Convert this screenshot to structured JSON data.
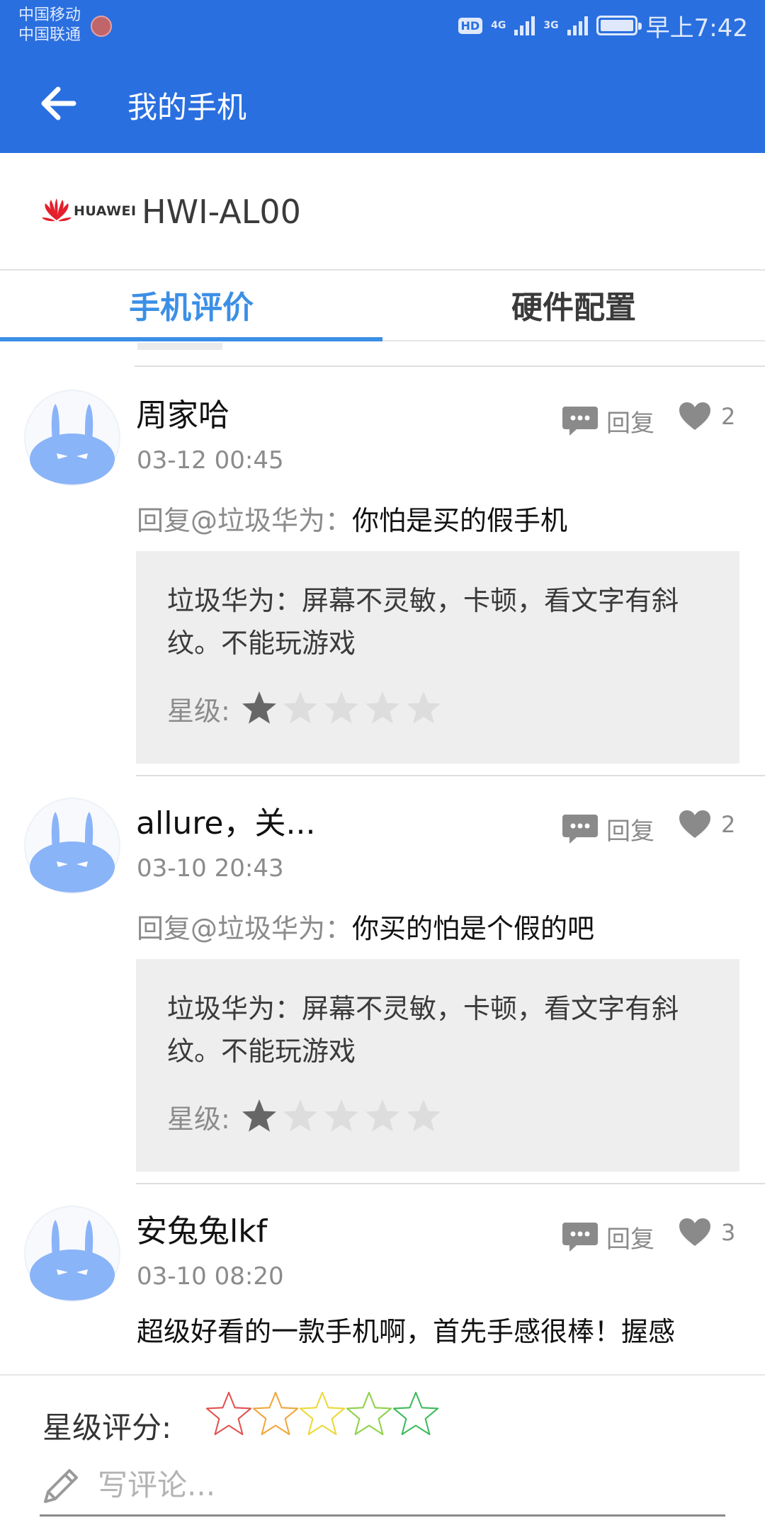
{
  "status_bar": {
    "carrier_1": "中国移动",
    "carrier_2": "中国联通",
    "hd_badge": "HD",
    "network_1": "4G",
    "network_2": "3G",
    "clock": "早上7:42"
  },
  "app_bar": {
    "title": "我的手机",
    "back_icon": "arrow-left-icon"
  },
  "device": {
    "brand": "HUAWEI",
    "model": "HWI-AL00",
    "brand_color": "#e41f2b"
  },
  "tabs": [
    {
      "label": "手机评价",
      "active": true
    },
    {
      "label": "硬件配置",
      "active": false
    }
  ],
  "comments": [
    {
      "author": "周家哈",
      "time": "03-12 00:45",
      "reply_label": "回复",
      "likes": "2",
      "reply_prefix": "回复@垃圾华为：",
      "reply_text": "你怕是买的假手机",
      "quote": "垃圾华为：屏幕不灵敏，卡顿，看文字有斜纹。不能玩游戏",
      "stars_label": "星级:",
      "rating": 1,
      "rating_max": 5
    },
    {
      "author": "allure，关...",
      "time": "03-10 20:43",
      "reply_label": "回复",
      "likes": "2",
      "reply_prefix": "回复@垃圾华为：",
      "reply_text": "你买的怕是个假的吧",
      "quote": "垃圾华为：屏幕不灵敏，卡顿，看文字有斜纹。不能玩游戏",
      "stars_label": "星级:",
      "rating": 1,
      "rating_max": 5
    },
    {
      "author": "安兔兔lkf",
      "time": "03-10 08:20",
      "reply_label": "回复",
      "likes": "3",
      "text": "超级好看的一款手机啊，首先手感很棒！握感"
    }
  ],
  "composer": {
    "rating_label": "星级评分:",
    "rating_star_colors": [
      "#e0534f",
      "#f0a63a",
      "#ecd83a",
      "#8fd24a",
      "#3dbb5b"
    ],
    "placeholder": "写评论...",
    "value": ""
  },
  "colors": {
    "app_bar": "#2a6fe0",
    "tab_active": "#3b8fe6",
    "avatar": "#8ab4f8",
    "star_filled": "#666666",
    "star_empty": "#dddddd"
  }
}
